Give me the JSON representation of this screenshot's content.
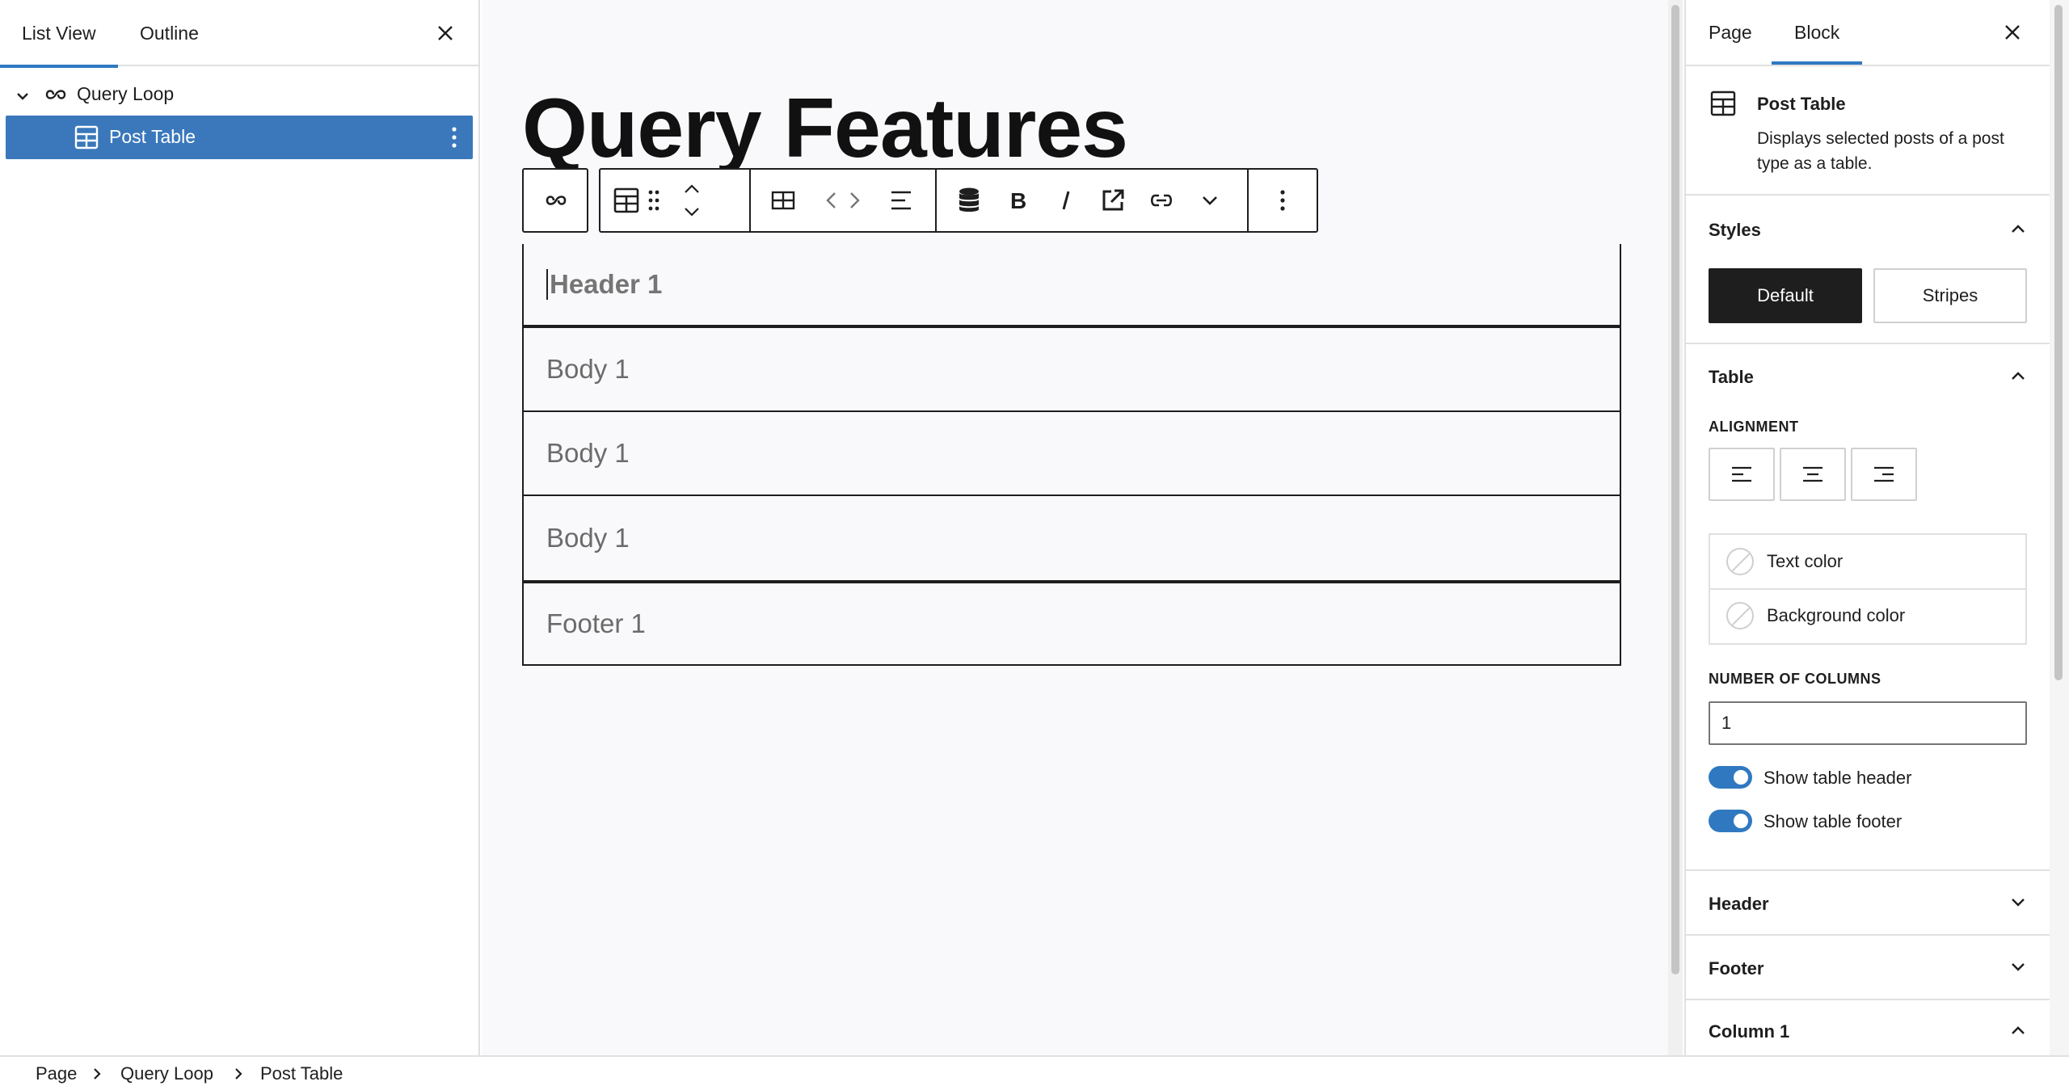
{
  "left_panel": {
    "tabs": [
      "List View",
      "Outline"
    ],
    "tree": [
      {
        "label": "Query Loop"
      },
      {
        "label": "Post Table"
      }
    ]
  },
  "canvas": {
    "title": "Query Features",
    "table": {
      "header": "Header 1",
      "body": [
        "Body 1",
        "Body 1",
        "Body 1"
      ],
      "footer": "Footer 1"
    }
  },
  "toolbar": {
    "icons": [
      "query-loop-icon",
      "table-icon",
      "drag-handle-icon",
      "move-up-icon",
      "move-down-icon",
      "table-grid-icon",
      "code-icon",
      "align-left-icon",
      "database-icon",
      "bold-icon",
      "italic-icon",
      "external-link-icon",
      "link-icon",
      "chevron-down-icon",
      "more-options-icon"
    ]
  },
  "sidebar": {
    "tabs": [
      "Page",
      "Block"
    ],
    "block": {
      "name": "Post Table",
      "description": "Displays selected posts of a post type as a table."
    },
    "styles": {
      "title": "Styles",
      "options": [
        "Default",
        "Stripes"
      ],
      "selected": "Default"
    },
    "table_panel": {
      "title": "Table",
      "alignment_label": "ALIGNMENT",
      "text_color": "Text color",
      "background_color": "Background color",
      "columns_label": "NUMBER OF COLUMNS",
      "columns_value": "1",
      "show_header": "Show table header",
      "show_footer": "Show table footer"
    },
    "collapsed_panels": [
      "Header",
      "Footer"
    ],
    "column_panel": "Column 1"
  },
  "breadcrumb": [
    "Page",
    "Query Loop",
    "Post Table"
  ],
  "colors": {
    "accent": "#3079c1",
    "selected_row": "#3a78bb",
    "dark": "#1e1e1e"
  }
}
